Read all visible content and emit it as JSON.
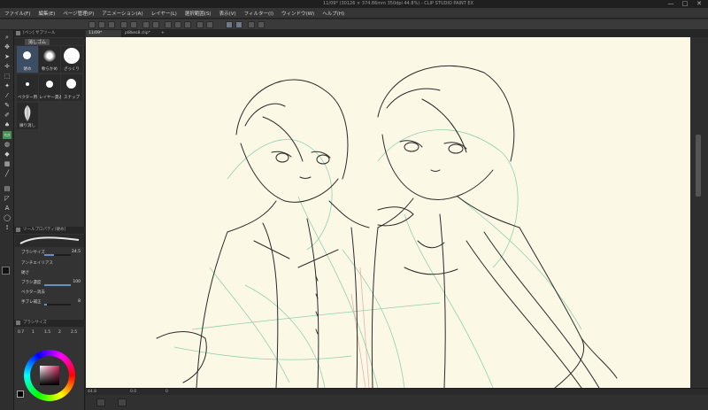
{
  "window": {
    "title": "11/09* (30126 × 374.86mm 350dpi 44.8%) - CLIP STUDIO PAINT EX",
    "minimize_glyph": "—",
    "maximize_glyph": "□",
    "close_glyph": "✕"
  },
  "menubar": {
    "items": [
      "ファイル(F)",
      "編集(E)",
      "ページ管理(P)",
      "アニメーション(A)",
      "レイヤー(L)",
      "選択範囲(S)",
      "表示(V)",
      "フィルター(I)",
      "ウィンドウ(W)",
      "ヘルプ(H)"
    ]
  },
  "document_tabs": [
    {
      "label": "11/09*",
      "active": true
    },
    {
      "label": "pl8kes8.clip*",
      "active": false
    },
    {
      "label": "+",
      "active": false
    }
  ],
  "subtool_panel": {
    "header": "[ペン] サブツール",
    "selected_group": "消しゴム",
    "brushes": [
      {
        "label": "硬め"
      },
      {
        "label": "軟らかめ"
      },
      {
        "label": "ざっくり"
      },
      {
        "label": "ベクター用"
      },
      {
        "label": "レイヤー貫通"
      },
      {
        "label": "スナップ"
      },
      {
        "label": "練り消し"
      }
    ]
  },
  "tool_property": {
    "header": "ツールプロパティ[硬め]",
    "rows": [
      {
        "label": "ブラシサイズ",
        "value": "24.5",
        "fill": 0.35
      },
      {
        "label": "アンチエイリアス",
        "value": "",
        "fill": 0.0
      },
      {
        "label": "硬さ",
        "value": "",
        "fill": 0.0
      },
      {
        "label": "ブラシ濃度",
        "value": "100",
        "fill": 1.0
      },
      {
        "label": "ベクター消去",
        "value": "",
        "fill": 0.0
      },
      {
        "label": "手ブレ補正",
        "value": "8",
        "fill": 0.1
      }
    ]
  },
  "brush_size_panel": {
    "header": "ブラシサイズ",
    "sizes": [
      "0.7",
      "1",
      "1.5",
      "2",
      "2.5"
    ]
  },
  "status": {
    "zoom": "44.8",
    "angle": "0.0",
    "position": "0"
  },
  "colors": {
    "canvas": "#fcf8e6",
    "line_art": "#2a2a2a",
    "sketch_green": "#7fc9a6",
    "sketch_red": "#e6a0a0",
    "accent_blue": "#3d4d63",
    "active_tool": "#4e8e5c"
  }
}
